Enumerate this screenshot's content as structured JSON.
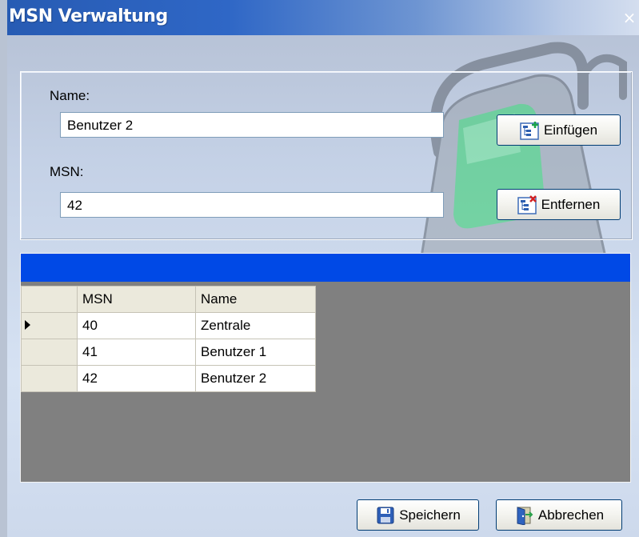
{
  "window": {
    "title": "MSN Verwaltung",
    "close_symbol": "×"
  },
  "form": {
    "name_label": "Name:",
    "name_value": "Benutzer 2",
    "msn_label": "MSN:",
    "msn_value": "42"
  },
  "buttons": {
    "insert_label": "Einfügen",
    "remove_label": "Entfernen",
    "save_label": "Speichern",
    "cancel_label": "Abbrechen"
  },
  "grid": {
    "columns": [
      "MSN",
      "Name"
    ],
    "rows": [
      {
        "msn": "40",
        "name": "Zentrale",
        "current": true
      },
      {
        "msn": "41",
        "name": "Benutzer 1",
        "current": false
      },
      {
        "msn": "42",
        "name": "Benutzer 2",
        "current": false
      }
    ]
  },
  "colors": {
    "title_bar": "#2f67c6",
    "grid_caption": "#0049e6",
    "grid_background": "#808080"
  },
  "icons": {
    "insert": "tree-add-icon",
    "remove": "tree-remove-icon",
    "save": "floppy-disk-icon",
    "cancel": "door-exit-icon",
    "row_pointer": "row-pointer-icon"
  }
}
